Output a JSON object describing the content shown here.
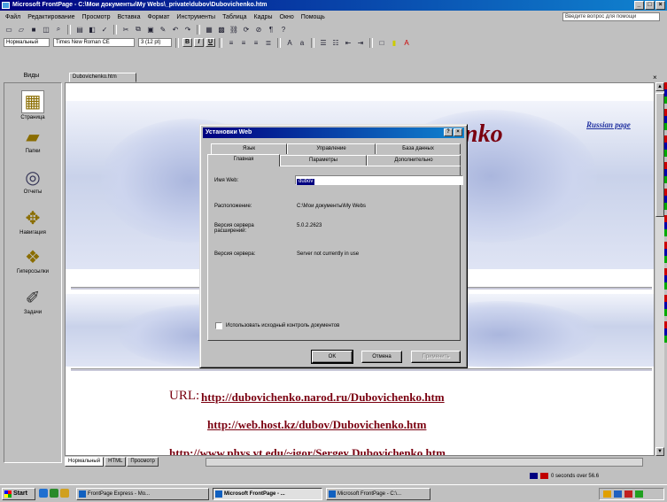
{
  "window": {
    "title": "Microsoft FrontPage - C:\\Мои документы\\My Webs\\_private\\dubov\\Dubovichenko.htm"
  },
  "menu": [
    "Файл",
    "Редактирование",
    "Просмотр",
    "Вставка",
    "Формат",
    "Инструменты",
    "Таблица",
    "Кадры",
    "Окно",
    "Помощь"
  ],
  "help_box": "Введите вопрос для помощи",
  "format_bar": {
    "style": "Нормальный",
    "font": "Times New Roman CE",
    "size": "3 (12 pt)",
    "bold": "B",
    "italic": "I",
    "underline": "U"
  },
  "views": {
    "label": "Виды",
    "items": [
      {
        "label": "Страница",
        "icon": "page-view-icon"
      },
      {
        "label": "Папки",
        "icon": "folders-view-icon"
      },
      {
        "label": "Отчеты",
        "icon": "reports-view-icon"
      },
      {
        "label": "Навигация",
        "icon": "navigation-view-icon"
      },
      {
        "label": "Гиперссылки",
        "icon": "hyperlinks-view-icon"
      },
      {
        "label": "Задачи",
        "icon": "tasks-view-icon"
      }
    ]
  },
  "document": {
    "tab": "Dubovichenko.htm",
    "russian_link": "Russian page",
    "heading_fragment": "nko",
    "url_label": "URL:",
    "links": [
      "http://dubovichenko.narod.ru/Dubovichenko.htm",
      "http://web.host.kz/dubov/Dubovichenko.htm",
      "http://www.phys.vt.edu/~igor/Sergey Dubovichenko.htm"
    ]
  },
  "bottom_tabs": [
    "Нормальный",
    "HTML",
    "Просмотр"
  ],
  "status": {
    "text": "0 seconds over 56.6"
  },
  "taskbar": {
    "start": "Start",
    "items": [
      {
        "label": "FrontPage Express - Mo...",
        "active": false
      },
      {
        "label": "Microsoft FrontPage - ...",
        "active": true
      },
      {
        "label": "Microsoft FrontPage - C:\\...",
        "active": false
      }
    ]
  },
  "dialog": {
    "title": "Установки Web",
    "tabs_back": [
      "Язык",
      "Управление",
      "База данных"
    ],
    "tabs_front": [
      "Главная",
      "Параметры",
      "Дополнительно"
    ],
    "fields": [
      {
        "label": "Имя Web:",
        "value": "dubov"
      },
      {
        "label": "Расположение:",
        "value": "C:\\Мои документы\\My Webs"
      },
      {
        "label": "Версия сервера расширений:",
        "value": "5.0.2.2623"
      },
      {
        "label": "Версия сервера:",
        "value": "Server not currently in use"
      }
    ],
    "checkbox": "Использовать исходный контроль документов",
    "buttons": {
      "ok": "OK",
      "cancel": "Отмена",
      "apply": "Применить"
    }
  },
  "colors": {
    "titlebar": "#000080",
    "link": "#7a0010",
    "russian_link": "#2030a0"
  }
}
